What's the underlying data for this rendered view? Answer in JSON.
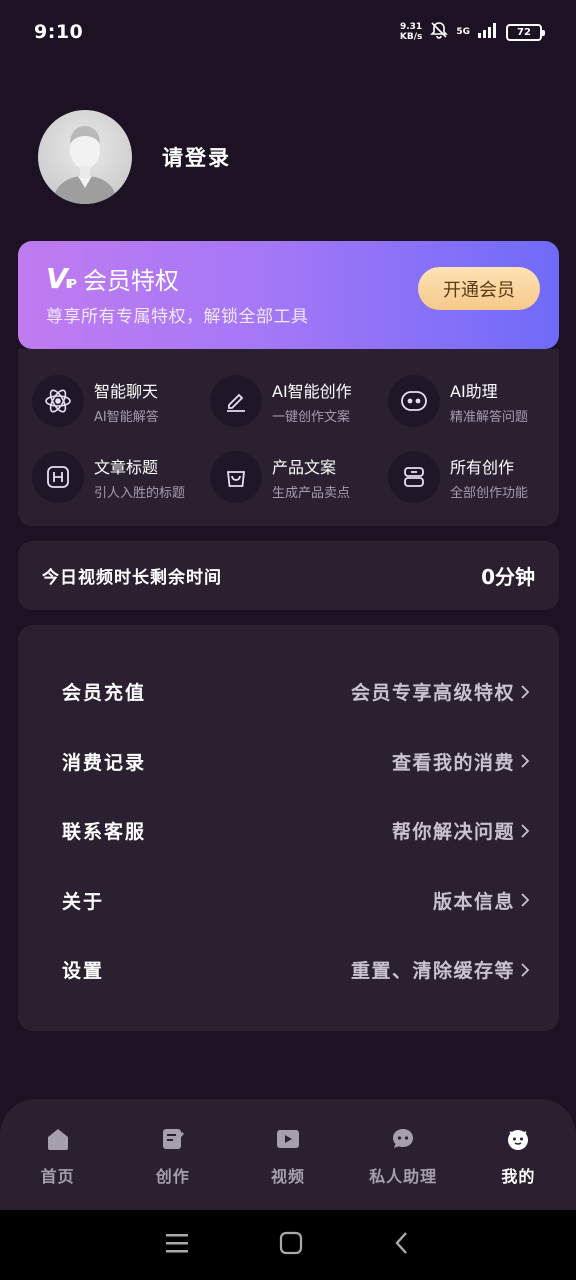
{
  "status": {
    "time": "9:10",
    "net_speed_value": "9.31",
    "net_speed_unit": "KB/s",
    "signal": "5G",
    "battery": "72"
  },
  "profile": {
    "login_label": "请登录"
  },
  "vip": {
    "logo_v": "V",
    "logo_ip": "IP",
    "title": "会员特权",
    "subtitle": "尊享所有专属特权，解锁全部工具",
    "button": "开通会员"
  },
  "features": [
    {
      "name": "智能聊天",
      "desc": "AI智能解答",
      "icon": "atom-icon"
    },
    {
      "name": "AI智能创作",
      "desc": "一键创作文案",
      "icon": "pencil-icon"
    },
    {
      "name": "AI助理",
      "desc": "精准解答问题",
      "icon": "robot-face-icon"
    },
    {
      "name": "文章标题",
      "desc": "引人入胜的标题",
      "icon": "heading-icon"
    },
    {
      "name": "产品文案",
      "desc": "生成产品卖点",
      "icon": "shopping-bag-icon"
    },
    {
      "name": "所有创作",
      "desc": "全部创作功能",
      "icon": "layers-icon"
    }
  ],
  "time_card": {
    "label": "今日视频时长剩余时间",
    "value": "0分钟"
  },
  "menu": [
    {
      "label": "会员充值",
      "value": "会员专享高级特权"
    },
    {
      "label": "消费记录",
      "value": "查看我的消费"
    },
    {
      "label": "联系客服",
      "value": "帮你解决问题"
    },
    {
      "label": "关于",
      "value": "版本信息"
    },
    {
      "label": "设置",
      "value": "重置、清除缓存等"
    }
  ],
  "tabs": [
    {
      "label": "首页",
      "icon": "home-icon",
      "active": false
    },
    {
      "label": "创作",
      "icon": "document-edit-icon",
      "active": false
    },
    {
      "label": "视频",
      "icon": "play-icon",
      "active": false
    },
    {
      "label": "私人助理",
      "icon": "chat-bubble-icon",
      "active": false
    },
    {
      "label": "我的",
      "icon": "face-icon",
      "active": true
    }
  ],
  "colors": {
    "background": "#1c1224",
    "card": "#2a2030",
    "vip_gradient_start": "#c07bf0",
    "vip_gradient_end": "#6f6bf8",
    "vip_button": "#f7c98a"
  }
}
